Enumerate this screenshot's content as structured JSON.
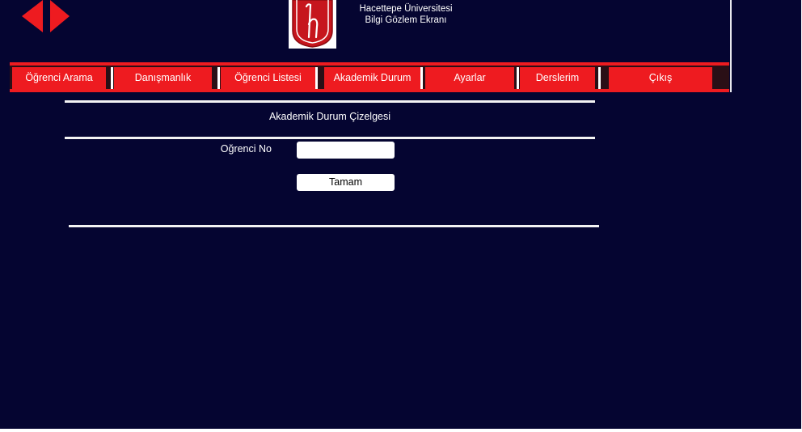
{
  "header": {
    "university_name": "Hacettepe Üniversitesi",
    "screen_name": "Bilgi Gözlem Ekranı",
    "logo_letter": "h",
    "accent_color": "#ee1b20",
    "background_color": "#050531"
  },
  "nav_arrows": {
    "back_icon": "arrow-left-icon",
    "forward_icon": "arrow-right-icon"
  },
  "menu": {
    "items": [
      {
        "label": "Öğrenci Arama"
      },
      {
        "label": "Danışmanlık"
      },
      {
        "label": "Öğrenci Listesi"
      },
      {
        "label": "Akademik Durum"
      },
      {
        "label": "Ayarlar"
      },
      {
        "label": "Derslerim"
      },
      {
        "label": "Çıkış"
      }
    ]
  },
  "main": {
    "title": "Akademik Durum Çizelgesi",
    "student_no_label": "Oğrenci No",
    "student_no_value": "",
    "submit_label": "Tamam"
  }
}
